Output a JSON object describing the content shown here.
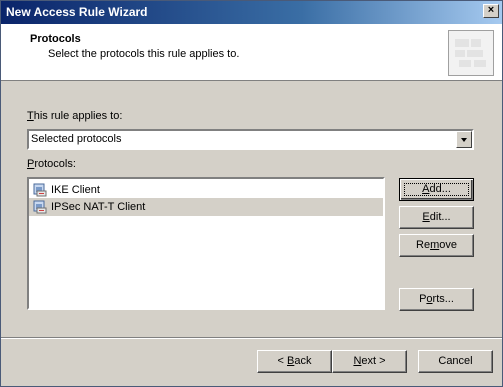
{
  "window": {
    "title": "New Access Rule Wizard",
    "close_glyph": "×"
  },
  "header": {
    "title": "Protocols",
    "subtitle": "Select the protocols this rule applies to."
  },
  "applies": {
    "label_u": "T",
    "label_rest": "his rule applies to:",
    "selected": "Selected protocols"
  },
  "protocols": {
    "label_u": "P",
    "label_rest": "rotocols:",
    "items": [
      {
        "name": "IKE Client",
        "icon": "protocol-icon"
      },
      {
        "name": "IPSec NAT-T Client",
        "icon": "protocol-icon"
      }
    ]
  },
  "side_buttons": {
    "add": {
      "u": "A",
      "rest": "dd..."
    },
    "edit": {
      "u": "E",
      "rest": "dit..."
    },
    "remove": {
      "pre": "Re",
      "u": "m",
      "rest": "ove"
    },
    "ports": {
      "pre": "P",
      "u": "o",
      "rest": "rts..."
    }
  },
  "footer": {
    "back": {
      "pre": "< ",
      "u": "B",
      "rest": "ack"
    },
    "next": {
      "u": "N",
      "rest": "ext >"
    },
    "cancel": "Cancel"
  },
  "colors": {
    "titlebar_start": "#0a246a",
    "titlebar_end": "#a6caf0",
    "face": "#d4d0c8"
  }
}
